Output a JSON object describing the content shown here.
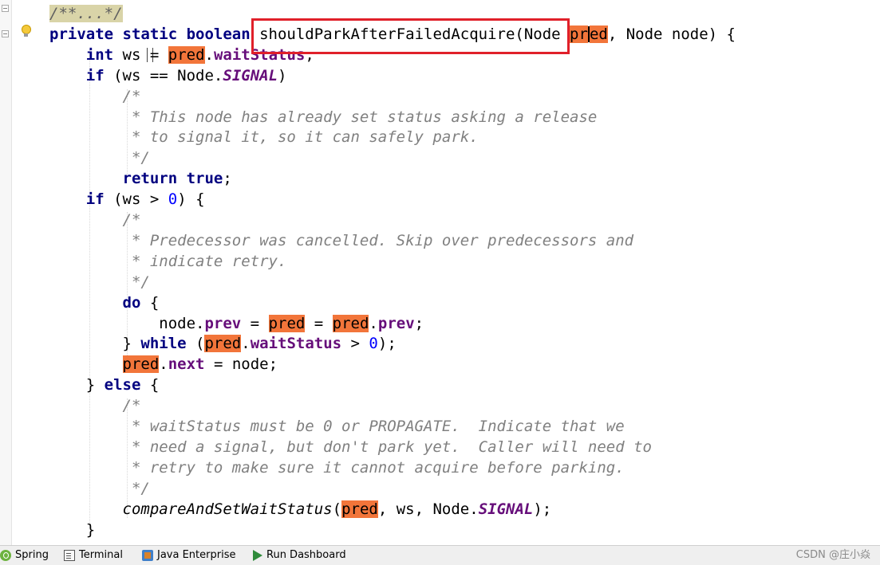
{
  "editor": {
    "lines": [
      [
        {
          "t": "/**...*/",
          "c": "foldcm"
        }
      ],
      [
        {
          "t": "private static boolean",
          "c": "kw"
        },
        {
          "t": " shouldParkAfterFailedAcquire(Node "
        },
        {
          "t": "pr",
          "c": "hl"
        },
        {
          "t": "CARET",
          "c": "caret"
        },
        {
          "t": "ed",
          "c": "hl"
        },
        {
          "t": ", Node node) {"
        }
      ],
      [
        {
          "t": "    "
        },
        {
          "t": "int",
          "c": "kw"
        },
        {
          "t": " ws "
        },
        {
          "t": "TEXTCARET",
          "c": "textcaret"
        },
        {
          "t": "= "
        },
        {
          "t": "pred",
          "c": "hl"
        },
        {
          "t": "."
        },
        {
          "t": "waitStatus",
          "c": "fld"
        },
        {
          "t": ";"
        }
      ],
      [
        {
          "t": "    "
        },
        {
          "t": "if",
          "c": "kw"
        },
        {
          "t": " (ws == Node."
        },
        {
          "t": "SIGNAL",
          "c": "fldi"
        },
        {
          "t": ")"
        }
      ],
      [
        {
          "t": "        /*",
          "c": "cm"
        }
      ],
      [
        {
          "t": "         * This node has already set status asking a release",
          "c": "cm"
        }
      ],
      [
        {
          "t": "         * to signal it, so it can safely park.",
          "c": "cm"
        }
      ],
      [
        {
          "t": "         */",
          "c": "cm"
        }
      ],
      [
        {
          "t": "        "
        },
        {
          "t": "return true",
          "c": "kw"
        },
        {
          "t": ";"
        }
      ],
      [
        {
          "t": "    "
        },
        {
          "t": "if",
          "c": "kw"
        },
        {
          "t": " (ws > "
        },
        {
          "t": "0",
          "c": "num"
        },
        {
          "t": ") {"
        }
      ],
      [
        {
          "t": "        /*",
          "c": "cm"
        }
      ],
      [
        {
          "t": "         * Predecessor was cancelled. Skip over predecessors and",
          "c": "cm"
        }
      ],
      [
        {
          "t": "         * indicate retry.",
          "c": "cm"
        }
      ],
      [
        {
          "t": "         */",
          "c": "cm"
        }
      ],
      [
        {
          "t": "        "
        },
        {
          "t": "do",
          "c": "kw"
        },
        {
          "t": " {"
        }
      ],
      [
        {
          "t": "            node."
        },
        {
          "t": "prev",
          "c": "fld"
        },
        {
          "t": " = "
        },
        {
          "t": "pred",
          "c": "hl"
        },
        {
          "t": " = "
        },
        {
          "t": "pred",
          "c": "hl"
        },
        {
          "t": "."
        },
        {
          "t": "prev",
          "c": "fld"
        },
        {
          "t": ";"
        }
      ],
      [
        {
          "t": "        } "
        },
        {
          "t": "while",
          "c": "kw"
        },
        {
          "t": " ("
        },
        {
          "t": "pred",
          "c": "hl"
        },
        {
          "t": "."
        },
        {
          "t": "waitStatus",
          "c": "fld"
        },
        {
          "t": " > "
        },
        {
          "t": "0",
          "c": "num"
        },
        {
          "t": ");"
        }
      ],
      [
        {
          "t": "        "
        },
        {
          "t": "pred",
          "c": "hl"
        },
        {
          "t": "."
        },
        {
          "t": "next",
          "c": "fld"
        },
        {
          "t": " = node;"
        }
      ],
      [
        {
          "t": "    } "
        },
        {
          "t": "else",
          "c": "kw"
        },
        {
          "t": " {"
        }
      ],
      [
        {
          "t": "        /*",
          "c": "cm"
        }
      ],
      [
        {
          "t": "         * waitStatus must be 0 or PROPAGATE.  Indicate that we",
          "c": "cm"
        }
      ],
      [
        {
          "t": "         * need a signal, but don't park yet.  Caller will need to",
          "c": "cm"
        }
      ],
      [
        {
          "t": "         * retry to make sure it cannot acquire before parking.",
          "c": "cm"
        }
      ],
      [
        {
          "t": "         */",
          "c": "cm"
        }
      ],
      [
        {
          "t": "        "
        },
        {
          "t": "compareAndSetWaitStatus",
          "c": "mi"
        },
        {
          "t": "("
        },
        {
          "t": "pred",
          "c": "hl"
        },
        {
          "t": ", ws, Node."
        },
        {
          "t": "SIGNAL",
          "c": "fldi"
        },
        {
          "t": ");"
        }
      ],
      [
        {
          "t": "    }"
        }
      ]
    ]
  },
  "toolwindows": [
    {
      "label": "Spring",
      "icon": "spring-icon"
    },
    {
      "label": "Terminal",
      "icon": "terminal-icon"
    },
    {
      "label": "Java Enterprise",
      "icon": "java-enterprise-icon"
    },
    {
      "label": "Run Dashboard",
      "icon": "run-dashboard-icon"
    }
  ],
  "watermark": "CSDN @庄小焱",
  "colors": {
    "keyword": "#000080",
    "field": "#660e7a",
    "number": "#0000ff",
    "comment": "#808080",
    "highlight": "#f2753a",
    "annotation": "#e0202a"
  }
}
